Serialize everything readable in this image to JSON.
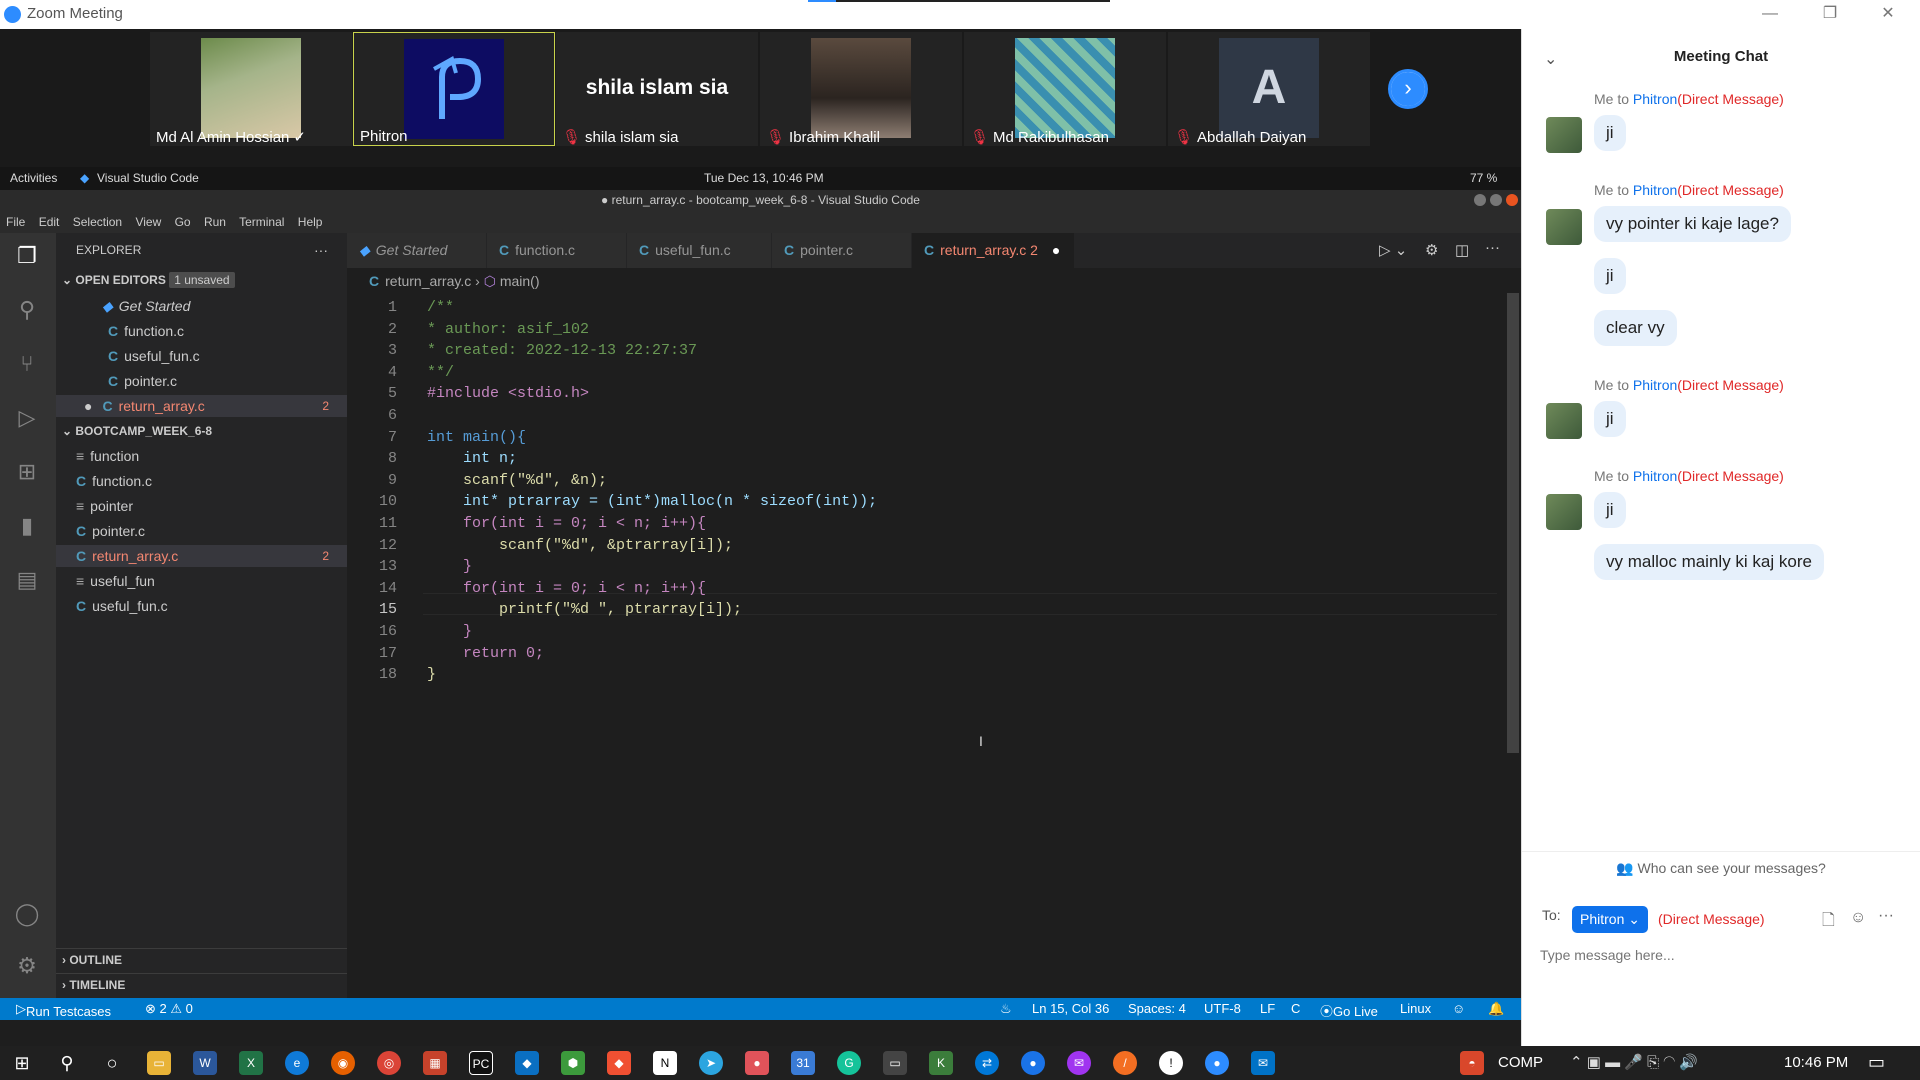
{
  "zoom": {
    "window_title": "Zoom Meeting",
    "participants": [
      {
        "name": "Md Al Amin Hossian",
        "mark": "✓"
      },
      {
        "name": "Phitron",
        "mark": ""
      },
      {
        "name": "shila islam sia",
        "mark": "🎤"
      },
      {
        "name": "Ibrahim Khalil",
        "mark": "🎤"
      },
      {
        "name": "Md Rakibulhasan",
        "mark": "🎤"
      },
      {
        "name": "Abdallah Daiyan",
        "mark": "🎤"
      }
    ],
    "big_name": "shila islam sia",
    "avatar_letter": "A"
  },
  "ubuntu": {
    "activities": "Activities",
    "app": "Visual Studio Code",
    "clock": "Tue Dec 13, 10:46 PM",
    "battery": "77 %"
  },
  "vscode": {
    "title": "● return_array.c - bootcamp_week_6-8 - Visual Studio Code",
    "menu": [
      "File",
      "Edit",
      "Selection",
      "View",
      "Go",
      "Run",
      "Terminal",
      "Help"
    ],
    "explorer_title": "EXPLORER",
    "open_editors": "OPEN EDITORS",
    "unsaved": "1 unsaved",
    "open_files": [
      "Get Started",
      "function.c",
      "useful_fun.c",
      "pointer.c",
      "return_array.c"
    ],
    "project": "BOOTCAMP_WEEK_6-8",
    "project_files": [
      "function",
      "function.c",
      "pointer",
      "pointer.c",
      "return_array.c",
      "useful_fun",
      "useful_fun.c"
    ],
    "error_count": "2",
    "outline": "OUTLINE",
    "timeline": "TIMELINE",
    "tabs": [
      "Get Started",
      "function.c",
      "useful_fun.c",
      "pointer.c",
      "return_array.c 2"
    ],
    "breadcrumb_file": "return_array.c",
    "breadcrumb_symbol": "main()",
    "code": [
      "/**",
      "* author: asif_102",
      "* created: 2022-12-13 22:27:37",
      "**/",
      "#include <stdio.h>",
      "",
      "int main(){",
      "    int n;",
      "    scanf(\"%d\", &n);",
      "    int* ptrarray = (int*)malloc(n * sizeof(int));",
      "    for(int i = 0; i < n; i++){",
      "        scanf(\"%d\", &ptrarray[i]);",
      "    }",
      "    for(int i = 0; i < n; i++){",
      "        printf(\"%d \", ptrarray[i]);",
      "    }",
      "    return 0;",
      "}"
    ],
    "status": {
      "run": "Run Testcases",
      "problems": "⊗ 2 ⚠ 0",
      "position": "Ln 15, Col 36",
      "spaces": "Spaces: 4",
      "encoding": "UTF-8",
      "eol": "LF",
      "lang": "C",
      "golive": "Go Live",
      "os": "Linux"
    }
  },
  "chat": {
    "title": "Meeting Chat",
    "me_to": "Me to",
    "recipient": "Phitron",
    "dm": "(Direct Message)",
    "groups": [
      {
        "messages": [
          "ji"
        ]
      },
      {
        "messages": [
          "vy pointer ki kaje lage?",
          "ji",
          "clear vy"
        ]
      },
      {
        "messages": [
          "ji"
        ]
      },
      {
        "messages": [
          "ji",
          "vy malloc mainly ki kaj kore"
        ]
      }
    ],
    "who_see": "Who can see your messages?",
    "to_label": "To:",
    "placeholder": "Type message here..."
  },
  "taskbar": {
    "comp": "COMP",
    "time": "10:46 PM"
  },
  "colors": {
    "zoom_blue": "#2d8cff",
    "vscode_status": "#007acc",
    "dm_red": "#e02828"
  }
}
